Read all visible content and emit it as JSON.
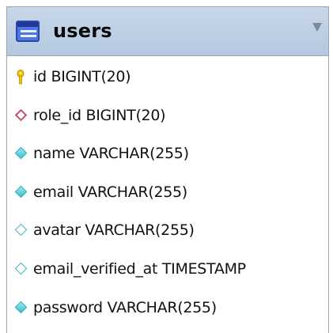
{
  "table": {
    "name": "users",
    "columns": [
      {
        "label": "id BIGINT(20)",
        "icon": "primary-key-icon",
        "color": "#f2c300"
      },
      {
        "label": "role_id BIGINT(20)",
        "icon": "foreign-key-diamond-icon",
        "color": "#c2536b"
      },
      {
        "label": "name VARCHAR(255)",
        "icon": "not-null-column-diamond-icon",
        "color": "#38bfcc"
      },
      {
        "label": "email VARCHAR(255)",
        "icon": "not-null-column-diamond-icon",
        "color": "#38bfcc"
      },
      {
        "label": "avatar VARCHAR(255)",
        "icon": "nullable-column-diamond-icon",
        "color": "#3ab0bf"
      },
      {
        "label": "email_verified_at TIMESTAMP",
        "icon": "nullable-column-diamond-icon",
        "color": "#3ab0bf"
      },
      {
        "label": "password VARCHAR(255)",
        "icon": "not-null-column-diamond-icon",
        "color": "#38bfcc"
      }
    ]
  },
  "colors": {
    "header_background": "#b3c8df",
    "table_icon": "#4f76e0",
    "border": "#9aa6b2"
  }
}
